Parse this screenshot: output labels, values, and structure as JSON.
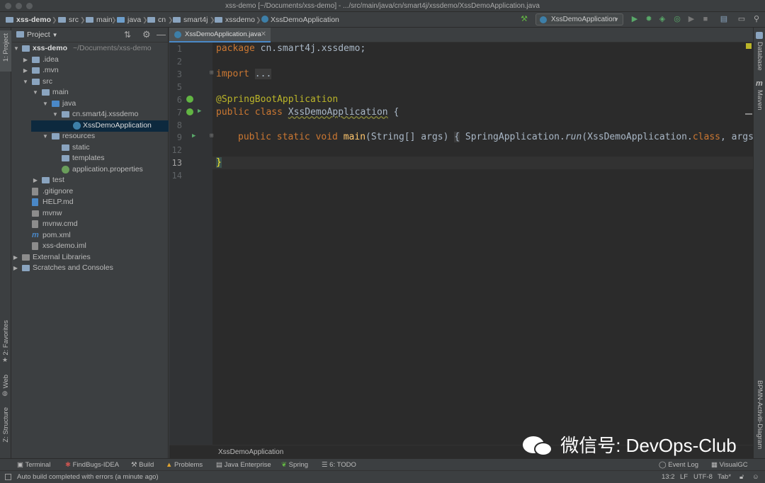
{
  "window": {
    "title": "xss-demo [~/Documents/xss-demo] - .../src/main/java/cn/smart4j/xssdemo/XssDemoApplication.java"
  },
  "navbar": {
    "crumbs": [
      "xss-demo",
      "src",
      "main",
      "java",
      "cn",
      "smart4j",
      "xssdemo",
      "XssDemoApplication"
    ],
    "run_config": "XssDemoApplication"
  },
  "side_tabs": {
    "project": "1: Project",
    "favorites": "2: Favorites",
    "web": "Web",
    "structure": "Z: Structure",
    "database": "Database",
    "maven": "Maven",
    "bpmn": "BPMN-Activiti-Diagram"
  },
  "project_panel": {
    "title": "Project"
  },
  "tree": [
    {
      "label": "xss-demo",
      "extra": "~/Documents/xss-demo",
      "bold": true
    },
    {
      "label": ".idea"
    },
    {
      "label": ".mvn"
    },
    {
      "label": "src"
    },
    {
      "label": "main"
    },
    {
      "label": "java"
    },
    {
      "label": "cn.smart4j.xssdemo"
    },
    {
      "label": "XssDemoApplication",
      "selected": true
    },
    {
      "label": "resources"
    },
    {
      "label": "static"
    },
    {
      "label": "templates"
    },
    {
      "label": "application.properties"
    },
    {
      "label": "test"
    },
    {
      "label": ".gitignore"
    },
    {
      "label": "HELP.md"
    },
    {
      "label": "mvnw"
    },
    {
      "label": "mvnw.cmd"
    },
    {
      "label": "pom.xml"
    },
    {
      "label": "xss-demo.iml"
    },
    {
      "label": "External Libraries"
    },
    {
      "label": "Scratches and Consoles"
    }
  ],
  "editor": {
    "tab": "XssDemoApplication.java",
    "line_numbers": [
      "1",
      "2",
      "3",
      "5",
      "6",
      "7",
      "8",
      "9",
      "12",
      "13",
      "14"
    ],
    "lines": {
      "l1a": "package",
      "l1b": " cn.smart4j.xssdemo;",
      "l3a": "import",
      "l3b": "...",
      "l6": "@SpringBootApplication",
      "l7a": "public class ",
      "l7b": "XssDemoApplication",
      "l7c": " {",
      "l9a": "public static void ",
      "l9b": "main",
      "l9c": "(String[] args) ",
      "l9d": "{",
      "l9e": " SpringApplication.",
      "l9f": "run",
      "l9g": "(XssDemoApplication.",
      "l9h": "class",
      "l9i": ", args)",
      "l13": "}"
    },
    "breadcrumb": "XssDemoApplication"
  },
  "toolwindows": [
    "Terminal",
    "FindBugs-IDEA",
    "Build",
    "Problems",
    "Java Enterprise",
    "Spring",
    "6: TODO",
    "Event Log",
    "VisualGC"
  ],
  "status": {
    "message": "Auto build completed with errors (a minute ago)",
    "position": "13:2",
    "line_sep": "LF",
    "encoding": "UTF-8",
    "indent": "Tab*"
  },
  "watermark": "微信号: DevOps-Club"
}
